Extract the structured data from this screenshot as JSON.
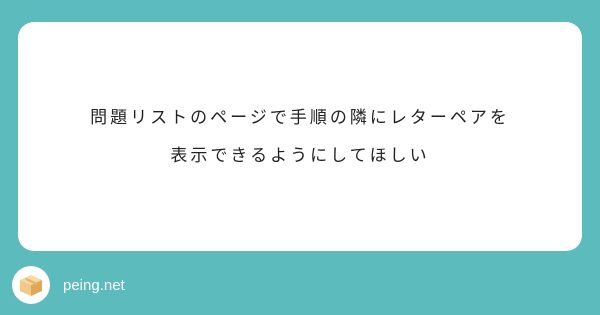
{
  "question": {
    "line1": "問題リストのページで手順の隣にレターペアを",
    "line2": "表示できるようにしてほしい"
  },
  "footer": {
    "brand": "peing.net",
    "logo_icon": "box-icon"
  },
  "colors": {
    "background": "#5cbbbd",
    "card": "#ffffff",
    "text": "#222222",
    "box_light": "#f3c889",
    "box_dark": "#e0a757"
  }
}
